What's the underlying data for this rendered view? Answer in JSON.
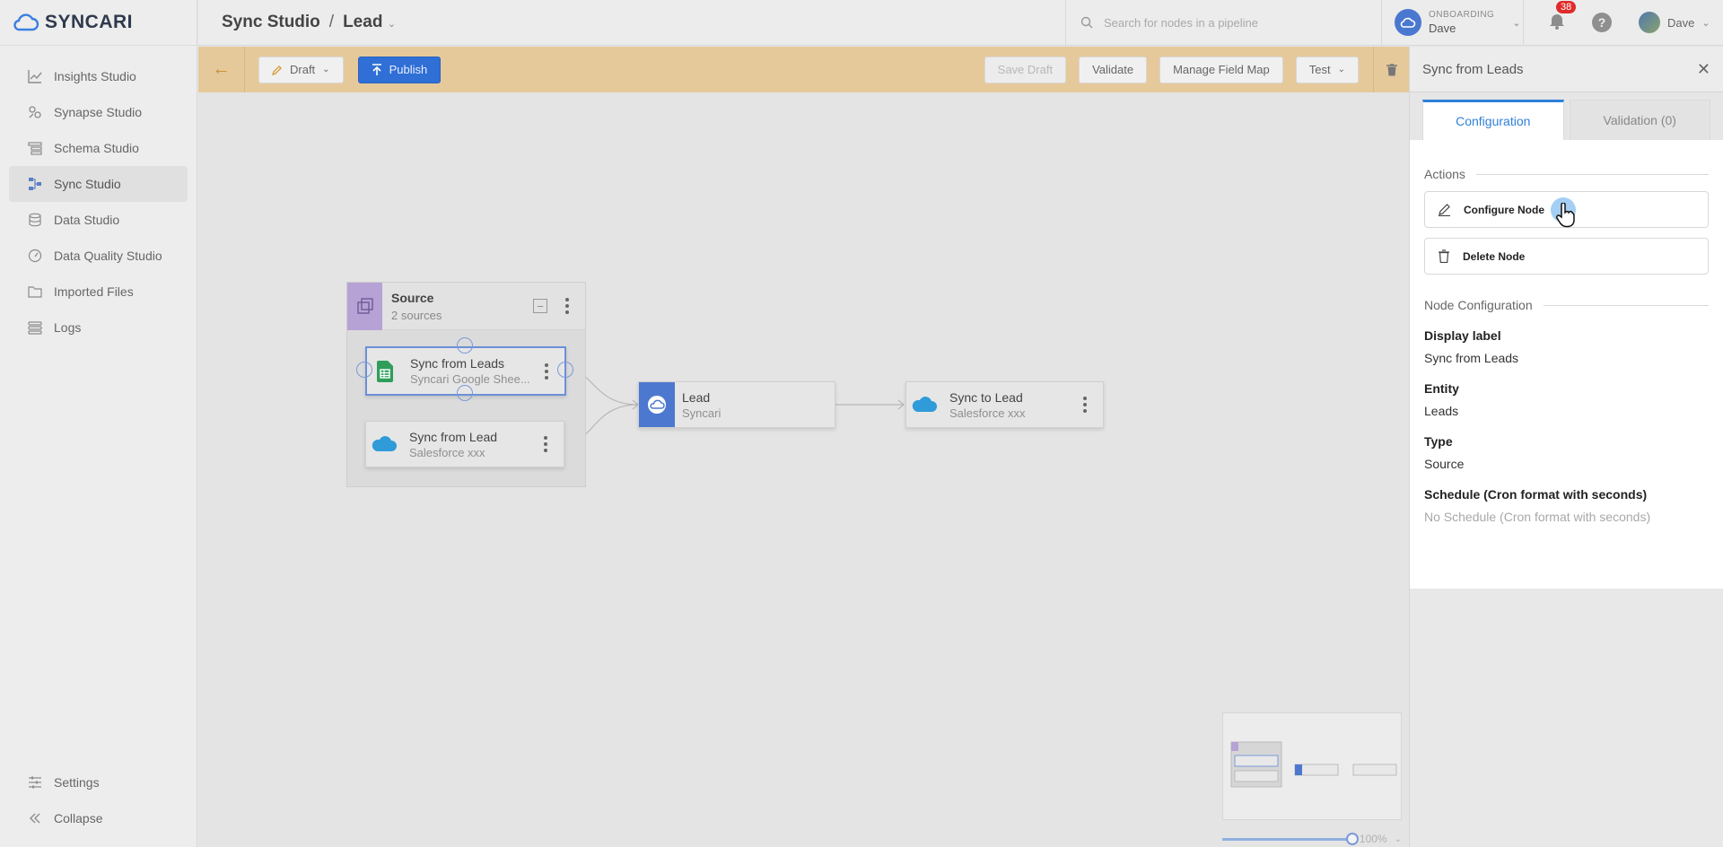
{
  "app": {
    "logo_text": "SYNCARI"
  },
  "sidebar": {
    "items": [
      {
        "label": "Insights Studio",
        "icon": "chart-icon"
      },
      {
        "label": "Synapse Studio",
        "icon": "synapse-icon"
      },
      {
        "label": "Schema Studio",
        "icon": "schema-icon"
      },
      {
        "label": "Sync Studio",
        "icon": "sync-icon",
        "active": true
      },
      {
        "label": "Data Studio",
        "icon": "database-icon"
      },
      {
        "label": "Data Quality Studio",
        "icon": "gauge-icon"
      },
      {
        "label": "Imported Files",
        "icon": "folder-icon"
      },
      {
        "label": "Logs",
        "icon": "logs-icon"
      }
    ],
    "bottom": [
      {
        "label": "Settings",
        "icon": "sliders-icon"
      },
      {
        "label": "Collapse",
        "icon": "collapse-icon"
      }
    ]
  },
  "header": {
    "breadcrumb_root": "Sync Studio",
    "breadcrumb_sep": "/",
    "breadcrumb_current": "Lead",
    "search_placeholder": "Search for nodes in a pipeline",
    "org_label": "ONBOARDING",
    "org_name": "Dave",
    "notification_count": "38",
    "help_label": "?",
    "user_name": "Dave"
  },
  "toolbar": {
    "draft_label": "Draft",
    "publish_label": "Publish",
    "save_draft_label": "Save Draft",
    "validate_label": "Validate",
    "manage_field_map_label": "Manage Field Map",
    "test_label": "Test"
  },
  "canvas": {
    "group": {
      "title": "Source",
      "subtitle": "2 sources"
    },
    "nodes": [
      {
        "title": "Sync from  Leads",
        "subtitle": "Syncari Google Shee..."
      },
      {
        "title": "Sync from Lead",
        "subtitle": "Salesforce xxx"
      },
      {
        "title": "Lead",
        "subtitle": "Syncari"
      },
      {
        "title": "Sync to Lead",
        "subtitle": "Salesforce xxx"
      }
    ],
    "zoom_label": "100%"
  },
  "panel": {
    "title": "Sync from Leads",
    "tabs": [
      "Configuration",
      "Validation (0)"
    ],
    "actions_heading": "Actions",
    "configure_label": "Configure Node",
    "delete_label": "Delete Node",
    "node_config_heading": "Node Configuration",
    "fields": [
      {
        "label": "Display label",
        "value": "Sync from Leads"
      },
      {
        "label": "Entity",
        "value": "Leads"
      },
      {
        "label": "Type",
        "value": "Source"
      },
      {
        "label": "Schedule (Cron format with seconds)",
        "value": "No Schedule (Cron format with seconds)",
        "placeholder": true
      }
    ]
  },
  "colors": {
    "accent": "#2f80d8",
    "toolbar_bg": "#e6c99b",
    "publish": "#2f6fd6",
    "badge": "#e02b2b"
  }
}
